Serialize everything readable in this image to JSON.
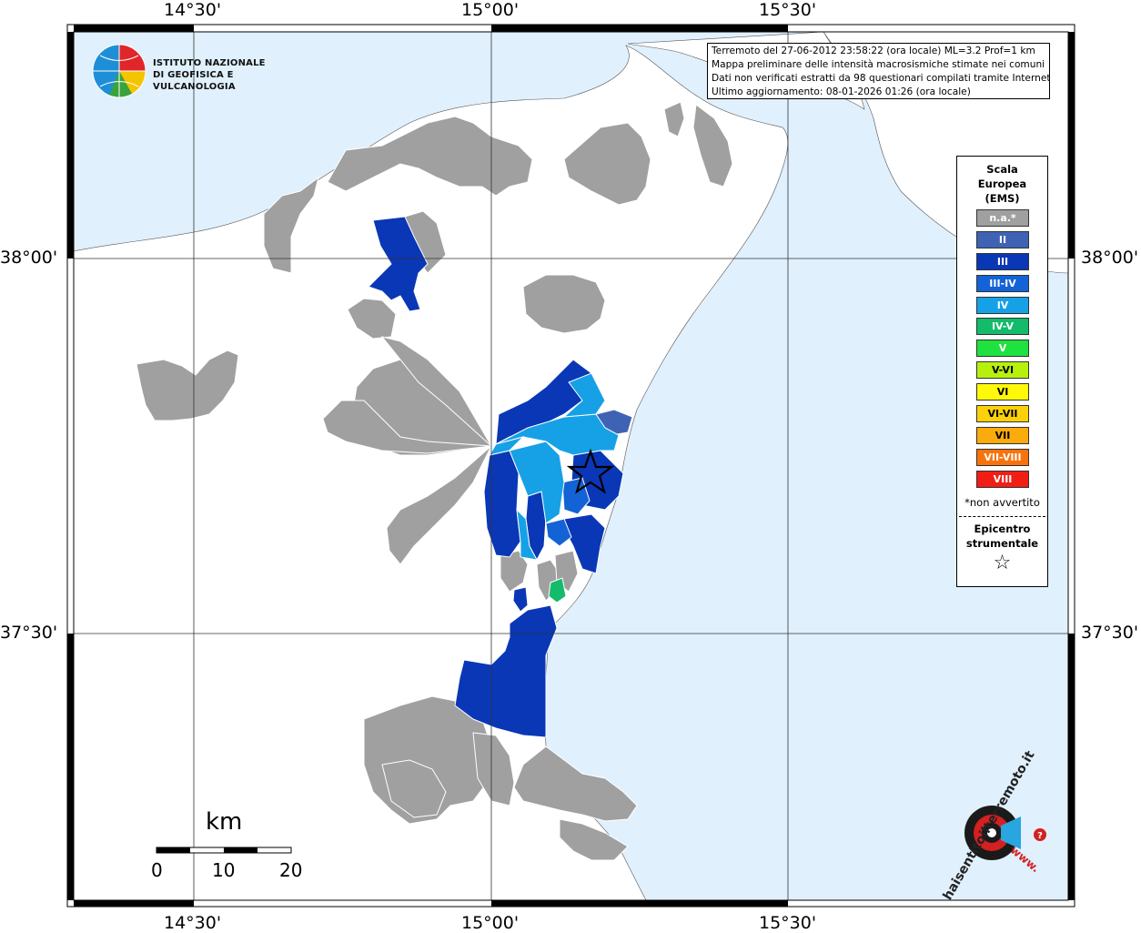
{
  "info": {
    "line1": "Terremoto del 27-06-2012 23:58:22 (ora locale) ML=3.2 Prof=1 km",
    "line2": "Mappa preliminare delle intensità macrosismiche stimate nei comuni",
    "line3": "Dati non verificati estratti da 98 questionari compilati tramite Internet.",
    "line4": "Ultimo aggiornamento: 08-01-2026 01:26 (ora locale)"
  },
  "logo": {
    "line1": "ISTITUTO NAZIONALE",
    "line2": "DI GEOFISICA E VULCANOLOGIA"
  },
  "ticks": {
    "top": [
      "14°30'",
      "15°00'",
      "15°30'"
    ],
    "bottom": [
      "14°30'",
      "15°00'",
      "15°30'"
    ],
    "left": [
      "38°00'",
      "37°30'"
    ],
    "right": [
      "38°00'",
      "37°30'"
    ]
  },
  "scale": {
    "unit": "km",
    "labels": [
      "0",
      "10",
      "20"
    ]
  },
  "legend": {
    "title1": "Scala",
    "title2": "Europea",
    "title3": "(EMS)",
    "items": [
      {
        "label": "n.a.*",
        "color": "#a0a0a0"
      },
      {
        "label": "II",
        "color": "#3f63b4"
      },
      {
        "label": "III",
        "color": "#0a37b6"
      },
      {
        "label": "III-IV",
        "color": "#1363d6"
      },
      {
        "label": "IV",
        "color": "#16a1e7"
      },
      {
        "label": "IV-V",
        "color": "#13bb6b"
      },
      {
        "label": "V",
        "color": "#1fe23e"
      },
      {
        "label": "V-VI",
        "color": "#b8f00e"
      },
      {
        "label": "VI",
        "color": "#fef90b"
      },
      {
        "label": "VI-VII",
        "color": "#fcd10a"
      },
      {
        "label": "VII",
        "color": "#fbab0c"
      },
      {
        "label": "VII-VIII",
        "color": "#f9730d"
      },
      {
        "label": "VIII",
        "color": "#f11e16"
      }
    ],
    "note": "*non avvertito",
    "epicenter1": "Epicentro",
    "epicenter2": "strumentale",
    "star": "☆"
  },
  "watermark": {
    "text": "haisentitoilterremoto.it",
    "url": "www."
  },
  "colors": {
    "sea": "#e0f0fd",
    "land": "#ffffff",
    "na": "#a0a0a0",
    "ii": "#3f63b4",
    "iii": "#0a37b6",
    "iii_iv": "#1363d6",
    "iv": "#16a1e7",
    "iv_v": "#13bb6b"
  }
}
